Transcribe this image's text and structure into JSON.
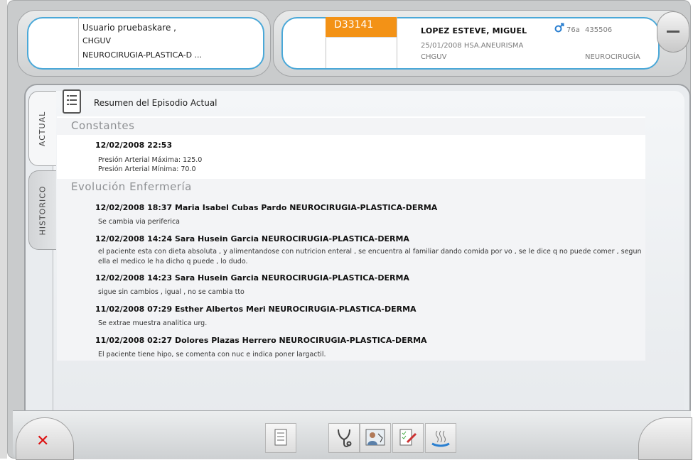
{
  "header": {
    "user_line": "Usuario pruebaskare ,",
    "center": "CHGUV",
    "service": "NEUROCIRUGIA-PLASTICA-D ...",
    "episode_code": "D33141",
    "patient_name": "LOPEZ ESTEVE, MIGUEL",
    "sex_icon": "male-icon",
    "age": "76a",
    "patient_id": "435506",
    "admission": "25/01/2008  HSA.ANEURISMA",
    "hospital": "CHGUV",
    "department": "NEUROCIRUGÍA",
    "accent_color": "#f39216",
    "highlight_color": "#4aa8d8"
  },
  "tabs": [
    {
      "label": "ACTUAL"
    },
    {
      "label": "HISTORICO"
    }
  ],
  "summary_title": "Resumen del Episodio Actual",
  "sections": {
    "constantes": {
      "title": "Constantes",
      "entry_date": "12/02/2008 22:53",
      "lines": [
        "Presión Arterial Máxima: 125.0",
        "Presión Arterial Mínima: 70.0"
      ]
    },
    "evolucion": {
      "title": "Evolución Enfermería",
      "entries": [
        {
          "header": "12/02/2008 18:37  Maria Isabel Cubas Pardo NEUROCIRUGIA-PLASTICA-DERMA",
          "text": "Se cambia via periferica"
        },
        {
          "header": "12/02/2008 14:24  Sara Husein Garcia NEUROCIRUGIA-PLASTICA-DERMA",
          "text": "el paciente esta con dieta absoluta , y alimentandose con nutricion enteral , se encuentra al familiar dando comida por vo , se le dice q no puede comer , segun ella el medico le ha dicho q puede , lo dudo."
        },
        {
          "header": "12/02/2008 14:23  Sara Husein Garcia NEUROCIRUGIA-PLASTICA-DERMA",
          "text": "sigue sin cambios , igual , no se cambia tto"
        },
        {
          "header": "11/02/2008 07:29  Esther Albertos Meri NEUROCIRUGIA-PLASTICA-DERMA",
          "text": "Se extrae muestra analitica urg."
        },
        {
          "header": "11/02/2008 02:27  Dolores Plazas Herrero NEUROCIRUGIA-PLASTICA-DERMA",
          "text": "El paciente tiene hipo, se comenta con nuc e indica poner largactil."
        }
      ]
    }
  },
  "toolbar": {
    "icons": [
      "summary-list-icon",
      "stethoscope-icon",
      "doctor-chart-icon",
      "checklist-edit-icon",
      "bath-steam-icon"
    ]
  },
  "close_icon": "close-icon"
}
